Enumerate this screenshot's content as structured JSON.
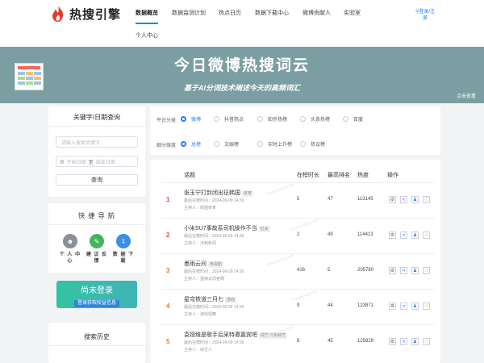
{
  "header": {
    "logo_text": "热搜引擎",
    "nav": [
      "数据概览",
      "数据监测计划",
      "热点日历",
      "数据下载中心",
      "微博贡献人",
      "实验室",
      "个人中心"
    ],
    "login": "登录/注册"
  },
  "banner": {
    "title": "今日微博热搜词云",
    "subtitle": "基于AI分词技术阐述今天的高频词汇",
    "mark": "点击查看"
  },
  "search": {
    "title": "关键字/日期查询",
    "keyword_placeholder": "请输入搜索关键字",
    "start_placeholder": "开始日期",
    "to": "至",
    "end_placeholder": "结束日期",
    "button": "查询"
  },
  "quick_nav": {
    "title": "快 捷 导 航",
    "items": [
      {
        "label": "个 人 中 心",
        "icon": "user-icon",
        "color": "#8a8f99"
      },
      {
        "label": "建 议 反 馈",
        "icon": "feedback-icon",
        "color": "#45b55c"
      },
      {
        "label": "数 据 下 载",
        "icon": "download-icon",
        "color": "#3a8ee6"
      }
    ]
  },
  "login_card": {
    "title": "尚未登录",
    "button": "登录获取权益信息"
  },
  "history": {
    "title": "搜索历史"
  },
  "filters": {
    "platform_label": "平台分类",
    "platforms": [
      "微博",
      "抖音热点",
      "知乎热榜",
      "头条热榜",
      "百度"
    ],
    "platform_selected": 0,
    "dimension_label": "细分维度",
    "dimensions": [
      "总榜",
      "文娱榜",
      "实时上升榜",
      "热议榜"
    ],
    "dimension_selected": 0
  },
  "table": {
    "headers": [
      "话题",
      "在榜时长",
      "最高排名",
      "热度",
      "操作"
    ],
    "rows": [
      {
        "rank": "1",
        "title": "张玉宁打封闭出征韩国",
        "tag": "体育",
        "time": "最后在榜时间：2024-06-09 14:36",
        "host": "主持人：绿茵体育",
        "duration": "5",
        "top": "47",
        "heat": "113145"
      },
      {
        "rank": "2",
        "title": "小米SU7事故系司机操作不当",
        "tag": "社会",
        "time": "最后在榜时间：2024-06-09 14:36",
        "host": "主持人：法制新闻",
        "duration": "2",
        "top": "49",
        "heat": "114413"
      },
      {
        "rank": "3",
        "title": "墨雨云间",
        "tag": "电视剧",
        "time": "最后在榜时间：2024-06-09 14:36",
        "host": "主持人：墨雨云间官微",
        "duration": "416",
        "top": "5",
        "heat": "205780"
      },
      {
        "rank": "4",
        "title": "星穹铁道三月七",
        "tag": "游戏",
        "time": "最后在榜时间：2024-06-09 14:36",
        "host": "主持人：游戏观察",
        "duration": "9",
        "top": "44",
        "heat": "123871"
      },
      {
        "rank": "5",
        "title": "袁娅维是歌手后采特邀嘉宾吧",
        "tag": "综艺 内地综艺",
        "time": "最后在榜时间：2024-06-09 14:36",
        "host": "主持人：综艺人",
        "duration": "8",
        "top": "45",
        "heat": "125829"
      }
    ],
    "row_colors": [
      "#e74c3c",
      "#e74c3c",
      "#e67e22",
      "#e67e22",
      "#e67e22"
    ],
    "action_icons": [
      "gear-icon",
      "share-icon",
      "like-icon",
      "star-icon"
    ],
    "action_colors": [
      "#666",
      "#3a8ee6",
      "#3a8ee6",
      "#e6a23c"
    ]
  },
  "watermark": "zhaoyujing.com"
}
